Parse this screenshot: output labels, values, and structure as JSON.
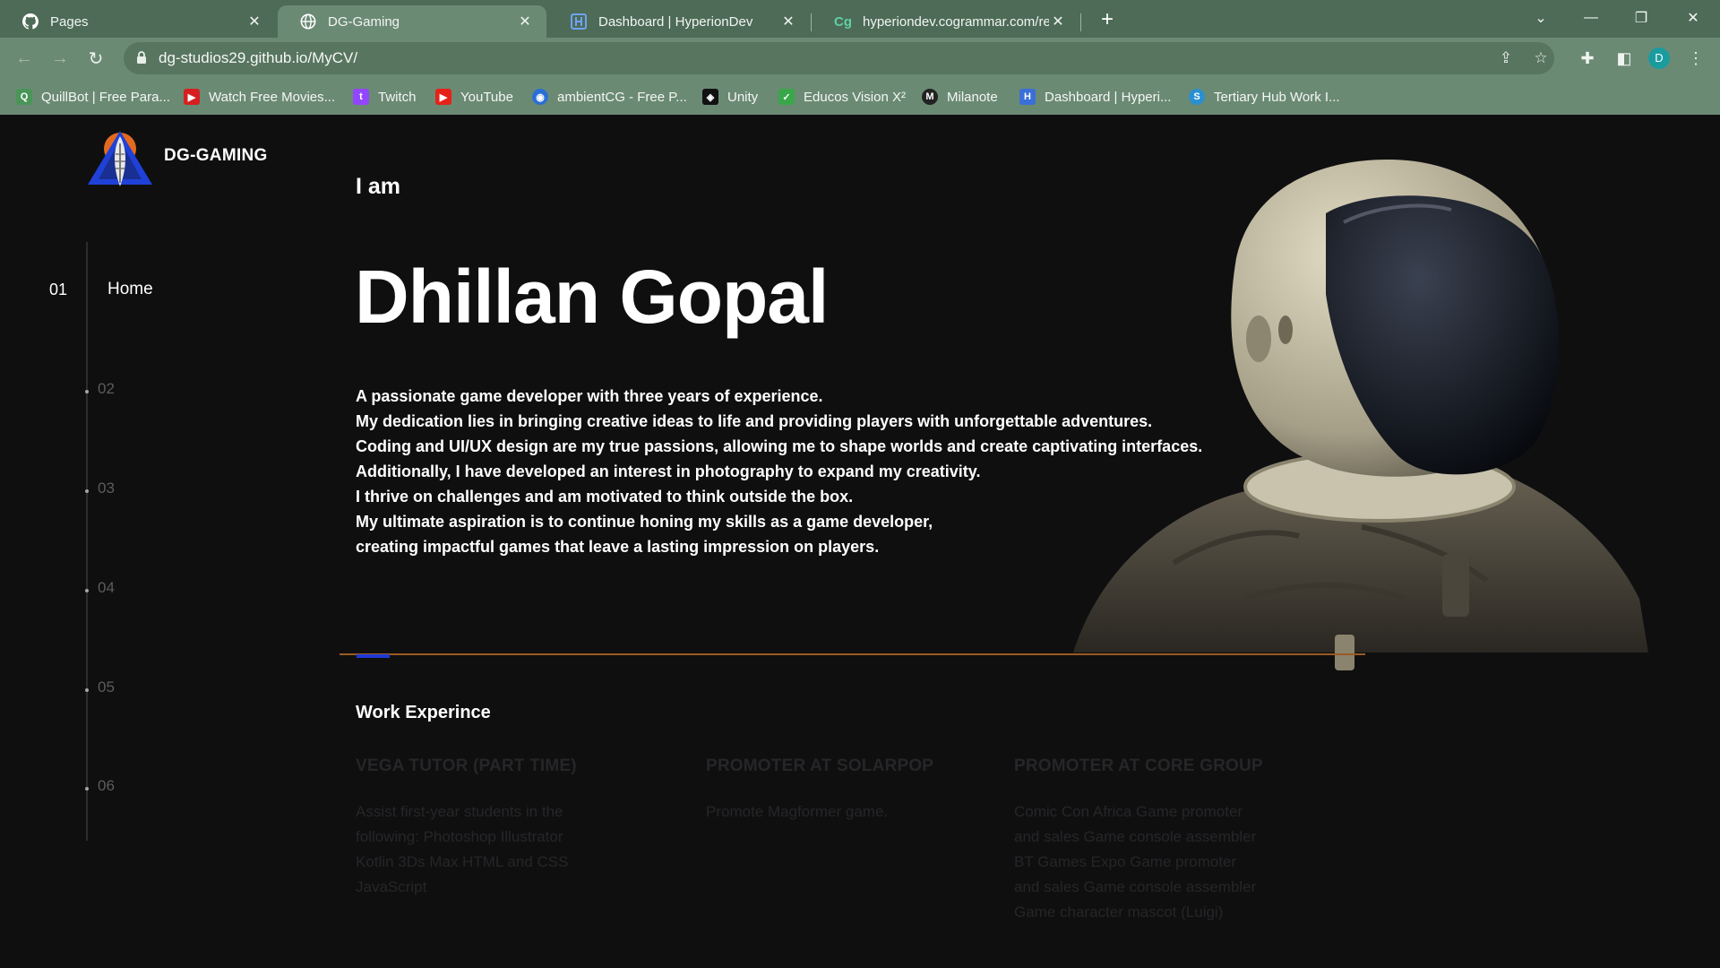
{
  "browser": {
    "tabs": [
      {
        "title": "Pages",
        "icon": "github-icon"
      },
      {
        "title": "DG-Gaming",
        "icon": "globe-icon",
        "active": true
      },
      {
        "title": "Dashboard | HyperionDev",
        "icon": "hyperiondev-icon"
      },
      {
        "title": "hyperiondev.cogrammar.com/rev",
        "icon": "cogrammar-icon"
      }
    ],
    "url": "dg-studios29.github.io/MyCV/",
    "avatar_letter": "D",
    "bookmarks": [
      {
        "label": "QuillBot | Free Para...",
        "icon": "quillbot-icon",
        "color": "#499557"
      },
      {
        "label": "Watch Free Movies...",
        "icon": "play-icon",
        "color": "#d62020"
      },
      {
        "label": "Twitch",
        "icon": "twitch-icon",
        "color": "#9146ff"
      },
      {
        "label": "YouTube",
        "icon": "youtube-icon",
        "color": "#e62117"
      },
      {
        "label": "ambientCG - Free P...",
        "icon": "ambientcg-icon",
        "color": "#2a6fd6"
      },
      {
        "label": "Unity",
        "icon": "unity-icon",
        "color": "#111111"
      },
      {
        "label": "Educos Vision X²",
        "icon": "educos-icon",
        "color": "#3aa64a"
      },
      {
        "label": "Milanote",
        "icon": "milanote-icon",
        "color": "#222222"
      },
      {
        "label": "Dashboard | Hyperi...",
        "icon": "hyperiondev-icon",
        "color": "#3a6fd8"
      },
      {
        "label": "Tertiary Hub Work I...",
        "icon": "tertiaryhub-icon",
        "color": "#2a8fd0"
      }
    ]
  },
  "site": {
    "brand": "DG-GAMING",
    "nav": {
      "active_number": "01",
      "active_label": "Home",
      "items": [
        "02",
        "03",
        "04",
        "05",
        "06"
      ]
    },
    "hero": {
      "intro": "I am",
      "name": "Dhillan Gopal",
      "bio": [
        "A passionate game developer with three years of experience.",
        "My dedication lies in bringing creative ideas to life and providing players with unforgettable adventures.",
        "Coding and UI/UX design are my true passions, allowing me to shape worlds and create captivating interfaces.",
        "Additionally, I have developed an interest in photography to expand my creativity.",
        "I thrive on challenges and am motivated to think outside the box.",
        "My ultimate aspiration is to continue honing my skills as a game developer,",
        "creating impactful games that leave a lasting impression on players."
      ]
    },
    "work": {
      "title": "Work Experince",
      "jobs": [
        {
          "title": "VEGA TUTOR (PART TIME)",
          "lines": [
            "Assist first-year students in the",
            "following: Photoshop Illustrator",
            "Kotlin 3Ds Max HTML and CSS",
            "JavaScript"
          ]
        },
        {
          "title": "PROMOTER AT SOLARPOP",
          "lines": [
            "Promote Magformer game."
          ]
        },
        {
          "title": "PROMOTER AT CORE GROUP",
          "lines": [
            "Comic Con Africa Game promoter",
            "and sales Game console assembler",
            "BT Games Expo Game promoter",
            "and sales Game console assembler",
            "Game character mascot (Luigi)"
          ]
        }
      ]
    }
  },
  "colors": {
    "chrome": "#4d6b57",
    "toolbar": "#6b8a74",
    "page_bg": "#0f0f10",
    "divider": "#9b5a22",
    "accent_blue": "#1e39d6"
  }
}
